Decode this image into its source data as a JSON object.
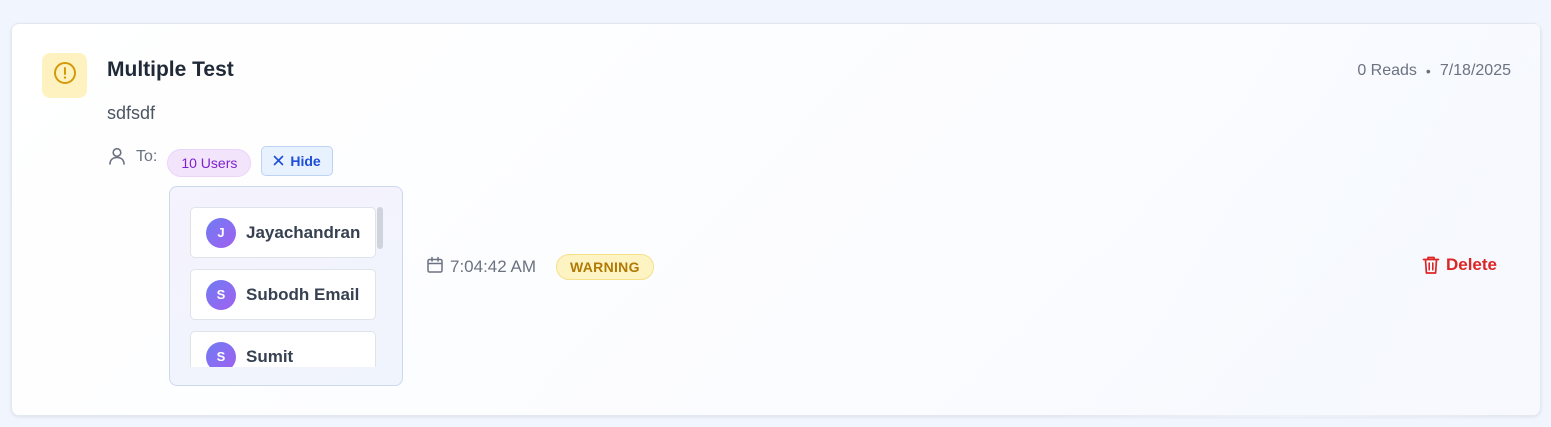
{
  "notification": {
    "title": "Multiple Test",
    "body": "sdfsdf",
    "reads": "0 Reads",
    "separator": "•",
    "date": "7/18/2025",
    "to_label": "To:",
    "users_count": "10 Users",
    "hide_label": "Hide",
    "time": "7:04:42 AM",
    "level": "WARNING",
    "delete_label": "Delete"
  },
  "recipients": [
    {
      "initial": "J",
      "name": "Jayachandran"
    },
    {
      "initial": "S",
      "name": "Subodh Email"
    },
    {
      "initial": "S",
      "name": "Sumit"
    }
  ],
  "colors": {
    "warning_accent": "#d4a017",
    "users_pill": "#7e22ce",
    "hide_button": "#1d4ed8",
    "delete": "#dc2626",
    "avatar_gradient": [
      "#6e7cf3",
      "#a260f0"
    ]
  },
  "icons": {
    "alert": "exclamation-circle-icon",
    "user": "user-icon",
    "close": "close-icon",
    "calendar": "calendar-icon",
    "trash": "trash-icon"
  }
}
